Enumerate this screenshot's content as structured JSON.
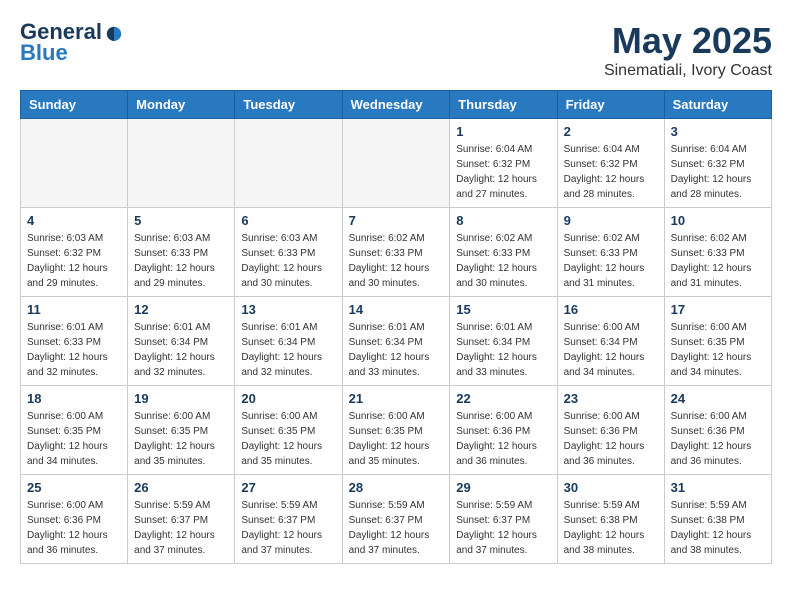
{
  "header": {
    "logo_line1": "General",
    "logo_line2": "Blue",
    "month": "May 2025",
    "location": "Sinematiali, Ivory Coast"
  },
  "weekdays": [
    "Sunday",
    "Monday",
    "Tuesday",
    "Wednesday",
    "Thursday",
    "Friday",
    "Saturday"
  ],
  "weeks": [
    [
      {
        "day": "",
        "info": ""
      },
      {
        "day": "",
        "info": ""
      },
      {
        "day": "",
        "info": ""
      },
      {
        "day": "",
        "info": ""
      },
      {
        "day": "1",
        "info": "Sunrise: 6:04 AM\nSunset: 6:32 PM\nDaylight: 12 hours\nand 27 minutes."
      },
      {
        "day": "2",
        "info": "Sunrise: 6:04 AM\nSunset: 6:32 PM\nDaylight: 12 hours\nand 28 minutes."
      },
      {
        "day": "3",
        "info": "Sunrise: 6:04 AM\nSunset: 6:32 PM\nDaylight: 12 hours\nand 28 minutes."
      }
    ],
    [
      {
        "day": "4",
        "info": "Sunrise: 6:03 AM\nSunset: 6:32 PM\nDaylight: 12 hours\nand 29 minutes."
      },
      {
        "day": "5",
        "info": "Sunrise: 6:03 AM\nSunset: 6:33 PM\nDaylight: 12 hours\nand 29 minutes."
      },
      {
        "day": "6",
        "info": "Sunrise: 6:03 AM\nSunset: 6:33 PM\nDaylight: 12 hours\nand 30 minutes."
      },
      {
        "day": "7",
        "info": "Sunrise: 6:02 AM\nSunset: 6:33 PM\nDaylight: 12 hours\nand 30 minutes."
      },
      {
        "day": "8",
        "info": "Sunrise: 6:02 AM\nSunset: 6:33 PM\nDaylight: 12 hours\nand 30 minutes."
      },
      {
        "day": "9",
        "info": "Sunrise: 6:02 AM\nSunset: 6:33 PM\nDaylight: 12 hours\nand 31 minutes."
      },
      {
        "day": "10",
        "info": "Sunrise: 6:02 AM\nSunset: 6:33 PM\nDaylight: 12 hours\nand 31 minutes."
      }
    ],
    [
      {
        "day": "11",
        "info": "Sunrise: 6:01 AM\nSunset: 6:33 PM\nDaylight: 12 hours\nand 32 minutes."
      },
      {
        "day": "12",
        "info": "Sunrise: 6:01 AM\nSunset: 6:34 PM\nDaylight: 12 hours\nand 32 minutes."
      },
      {
        "day": "13",
        "info": "Sunrise: 6:01 AM\nSunset: 6:34 PM\nDaylight: 12 hours\nand 32 minutes."
      },
      {
        "day": "14",
        "info": "Sunrise: 6:01 AM\nSunset: 6:34 PM\nDaylight: 12 hours\nand 33 minutes."
      },
      {
        "day": "15",
        "info": "Sunrise: 6:01 AM\nSunset: 6:34 PM\nDaylight: 12 hours\nand 33 minutes."
      },
      {
        "day": "16",
        "info": "Sunrise: 6:00 AM\nSunset: 6:34 PM\nDaylight: 12 hours\nand 34 minutes."
      },
      {
        "day": "17",
        "info": "Sunrise: 6:00 AM\nSunset: 6:35 PM\nDaylight: 12 hours\nand 34 minutes."
      }
    ],
    [
      {
        "day": "18",
        "info": "Sunrise: 6:00 AM\nSunset: 6:35 PM\nDaylight: 12 hours\nand 34 minutes."
      },
      {
        "day": "19",
        "info": "Sunrise: 6:00 AM\nSunset: 6:35 PM\nDaylight: 12 hours\nand 35 minutes."
      },
      {
        "day": "20",
        "info": "Sunrise: 6:00 AM\nSunset: 6:35 PM\nDaylight: 12 hours\nand 35 minutes."
      },
      {
        "day": "21",
        "info": "Sunrise: 6:00 AM\nSunset: 6:35 PM\nDaylight: 12 hours\nand 35 minutes."
      },
      {
        "day": "22",
        "info": "Sunrise: 6:00 AM\nSunset: 6:36 PM\nDaylight: 12 hours\nand 36 minutes."
      },
      {
        "day": "23",
        "info": "Sunrise: 6:00 AM\nSunset: 6:36 PM\nDaylight: 12 hours\nand 36 minutes."
      },
      {
        "day": "24",
        "info": "Sunrise: 6:00 AM\nSunset: 6:36 PM\nDaylight: 12 hours\nand 36 minutes."
      }
    ],
    [
      {
        "day": "25",
        "info": "Sunrise: 6:00 AM\nSunset: 6:36 PM\nDaylight: 12 hours\nand 36 minutes."
      },
      {
        "day": "26",
        "info": "Sunrise: 5:59 AM\nSunset: 6:37 PM\nDaylight: 12 hours\nand 37 minutes."
      },
      {
        "day": "27",
        "info": "Sunrise: 5:59 AM\nSunset: 6:37 PM\nDaylight: 12 hours\nand 37 minutes."
      },
      {
        "day": "28",
        "info": "Sunrise: 5:59 AM\nSunset: 6:37 PM\nDaylight: 12 hours\nand 37 minutes."
      },
      {
        "day": "29",
        "info": "Sunrise: 5:59 AM\nSunset: 6:37 PM\nDaylight: 12 hours\nand 37 minutes."
      },
      {
        "day": "30",
        "info": "Sunrise: 5:59 AM\nSunset: 6:38 PM\nDaylight: 12 hours\nand 38 minutes."
      },
      {
        "day": "31",
        "info": "Sunrise: 5:59 AM\nSunset: 6:38 PM\nDaylight: 12 hours\nand 38 minutes."
      }
    ]
  ]
}
